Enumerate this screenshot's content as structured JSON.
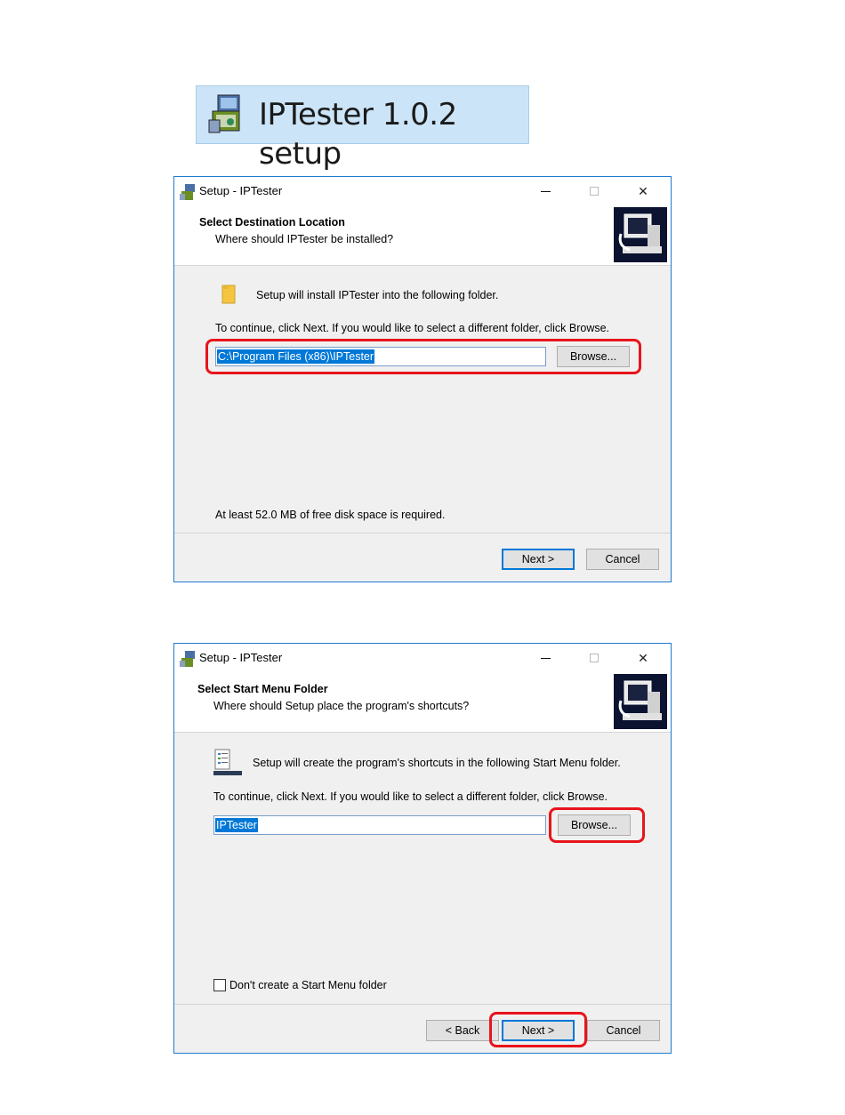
{
  "banner": {
    "text": "IPTester 1.0.2 setup",
    "icon": "installer-icon"
  },
  "dialog1": {
    "title": "Setup - IPTester",
    "heading": "Select Destination Location",
    "subheading": "Where should IPTester be installed?",
    "info": "Setup will install IPTester into the following folder.",
    "instruction": "To continue, click Next. If you would like to select a different folder, click Browse.",
    "path_value": "C:\\Program Files (x86)\\IPTester",
    "browse_label": "Browse...",
    "disk_space": "At least 52.0 MB of free disk space is required.",
    "next_label": "Next >",
    "cancel_label": "Cancel"
  },
  "dialog2": {
    "title": "Setup - IPTester",
    "heading": "Select Start Menu Folder",
    "subheading": "Where should Setup place the program's shortcuts?",
    "info": "Setup will create the program's shortcuts in the following Start Menu folder.",
    "instruction": "To continue, click Next. If you would like to select a different folder, click Browse.",
    "folder_value": "IPTester",
    "browse_label": "Browse...",
    "checkbox_label": "Don't create a Start Menu folder",
    "back_label": "< Back",
    "next_label": "Next >",
    "cancel_label": "Cancel"
  },
  "colors": {
    "highlight": "#e8141b",
    "selection": "#0078d7",
    "banner_bg": "#cce4f7"
  }
}
